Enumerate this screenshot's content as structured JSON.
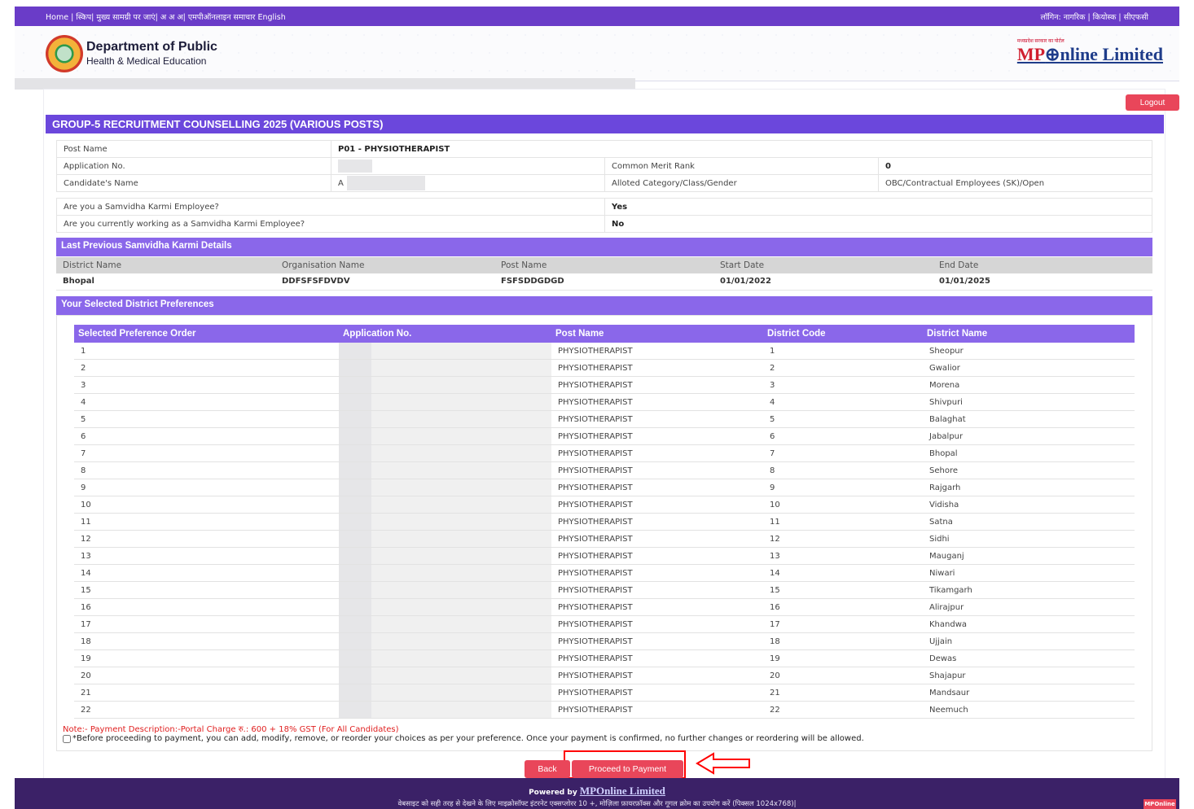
{
  "topbar": {
    "left_links": "Home | स्किप| मुख्य सामग्री पर जाएं| अ अ अ| एमपीऑनलाइन समाचार English",
    "right_links": "लॉगिन: नागरिक | कियोस्क | सीएफसी"
  },
  "header": {
    "dept_line1": "Department of Public",
    "dept_line2": "Health & Medical Education",
    "mponline_tag": "मध्यप्रदेश सरकार का पोर्टल",
    "mponline_brand_prefix": "MP",
    "mponline_brand_rest": "nline Limited"
  },
  "logout_label": "Logout",
  "page_title": "GROUP-5 RECRUITMENT COUNSELLING 2025 (VARIOUS POSTS)",
  "candidate": {
    "post_name_label": "Post Name",
    "post_name_value": "P01 - PHYSIOTHERAPIST",
    "application_no_label": "Application No.",
    "application_no_value": "",
    "common_merit_rank_label": "Common Merit Rank",
    "common_merit_rank_value": "0",
    "candidate_name_label": "Candidate's Name",
    "candidate_name_value": "A",
    "allotted_category_label": "Alloted Category/Class/Gender",
    "allotted_category_value": "OBC/Contractual Employees (SK)/Open"
  },
  "samvidha": {
    "q1_label": "Are you a Samvidha Karmi Employee?",
    "q1_value": "Yes",
    "q2_label": "Are you currently working as a Samvidha Karmi Employee?",
    "q2_value": "No"
  },
  "last_previous": {
    "title": "Last Previous Samvidha Karmi Details",
    "headers": [
      "District Name",
      "Organisation Name",
      "Post Name",
      "Start Date",
      "End Date"
    ],
    "row": [
      "Bhopal",
      "DDFSFSFDVDV",
      "FSFSDDGDGD",
      "01/01/2022",
      "01/01/2025"
    ]
  },
  "preferences": {
    "title": "Your Selected District Preferences",
    "headers": [
      "Selected Preference Order",
      "Application No.",
      "Post Name",
      "District Code",
      "District Name"
    ],
    "rows": [
      [
        "1",
        "",
        "PHYSIOTHERAPIST",
        "1",
        "Sheopur"
      ],
      [
        "2",
        "",
        "PHYSIOTHERAPIST",
        "2",
        "Gwalior"
      ],
      [
        "3",
        "",
        "PHYSIOTHERAPIST",
        "3",
        "Morena"
      ],
      [
        "4",
        "",
        "PHYSIOTHERAPIST",
        "4",
        "Shivpuri"
      ],
      [
        "5",
        "",
        "PHYSIOTHERAPIST",
        "5",
        "Balaghat"
      ],
      [
        "6",
        "",
        "PHYSIOTHERAPIST",
        "6",
        "Jabalpur"
      ],
      [
        "7",
        "",
        "PHYSIOTHERAPIST",
        "7",
        "Bhopal"
      ],
      [
        "8",
        "",
        "PHYSIOTHERAPIST",
        "8",
        "Sehore"
      ],
      [
        "9",
        "",
        "PHYSIOTHERAPIST",
        "9",
        "Rajgarh"
      ],
      [
        "10",
        "",
        "PHYSIOTHERAPIST",
        "10",
        "Vidisha"
      ],
      [
        "11",
        "",
        "PHYSIOTHERAPIST",
        "11",
        "Satna"
      ],
      [
        "12",
        "",
        "PHYSIOTHERAPIST",
        "12",
        "Sidhi"
      ],
      [
        "13",
        "",
        "PHYSIOTHERAPIST",
        "13",
        "Mauganj"
      ],
      [
        "14",
        "",
        "PHYSIOTHERAPIST",
        "14",
        "Niwari"
      ],
      [
        "15",
        "",
        "PHYSIOTHERAPIST",
        "15",
        "Tikamgarh"
      ],
      [
        "16",
        "",
        "PHYSIOTHERAPIST",
        "16",
        "Alirajpur"
      ],
      [
        "17",
        "",
        "PHYSIOTHERAPIST",
        "17",
        "Khandwa"
      ],
      [
        "18",
        "",
        "PHYSIOTHERAPIST",
        "18",
        "Ujjain"
      ],
      [
        "19",
        "",
        "PHYSIOTHERAPIST",
        "19",
        "Dewas"
      ],
      [
        "20",
        "",
        "PHYSIOTHERAPIST",
        "20",
        "Shajapur"
      ],
      [
        "21",
        "",
        "PHYSIOTHERAPIST",
        "21",
        "Mandsaur"
      ],
      [
        "22",
        "",
        "PHYSIOTHERAPIST",
        "22",
        "Neemuch"
      ]
    ]
  },
  "note": "Note:- Payment Description:-Portal Charge रु.: 600 + 18% GST (For All Candidates)",
  "confirm_text": "*Before proceeding to payment, you can add, modify, remove, or reorder your choices as per your preference. Once your payment is confirmed, no further changes or reordering will be allowed.",
  "buttons": {
    "back": "Back",
    "proceed": "Proceed to Payment"
  },
  "footer": {
    "powered_by": "Powered by",
    "brand": "MPOnline Limited",
    "browser_text": "वेबसाइट को सही तरह से देखने के लिए माइक्रोसॉफ्ट इंटरनेट एक्सप्लोरर 10 +, मोज़िला फ़ायरफ़ॉक्स और गूगल क्रोम का उपयोग करें (पिक्सल 1024x768)|",
    "badge": "MPOnline"
  },
  "colors": {
    "primary_purple": "#6b47dc",
    "light_purple": "#8a67ea",
    "button_red": "#e9465a",
    "footer_dark": "#3b2167"
  }
}
